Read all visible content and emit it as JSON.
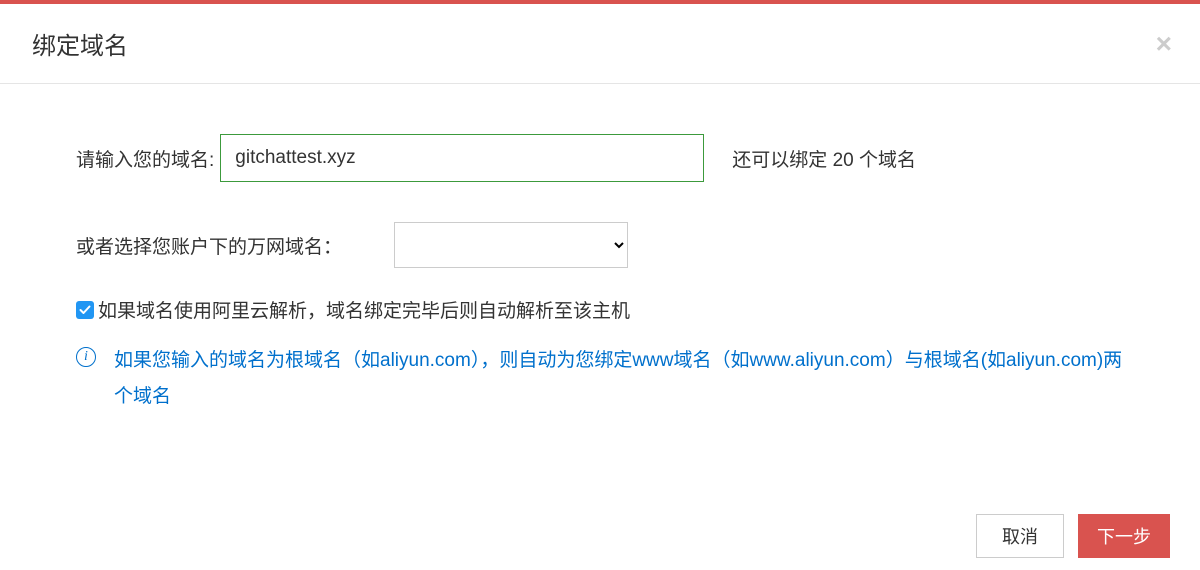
{
  "modal": {
    "title": "绑定域名",
    "close_label": "×"
  },
  "form": {
    "domain_label": "请输入您的域名:",
    "domain_value": "gitchattest.xyz",
    "remaining_prefix": "还可以绑定 ",
    "remaining_count": "20",
    "remaining_suffix": " 个域名",
    "select_label": "或者选择您账户下的万网域名：",
    "select_value": "",
    "checkbox_checked": true,
    "checkbox_label": "如果域名使用阿里云解析，域名绑定完毕后则自动解析至该主机",
    "info_text": "如果您输入的域名为根域名（如aliyun.com），则自动为您绑定www域名（如www.aliyun.com）与根域名(如aliyun.com)两个域名"
  },
  "footer": {
    "cancel_label": "取消",
    "next_label": "下一步"
  }
}
